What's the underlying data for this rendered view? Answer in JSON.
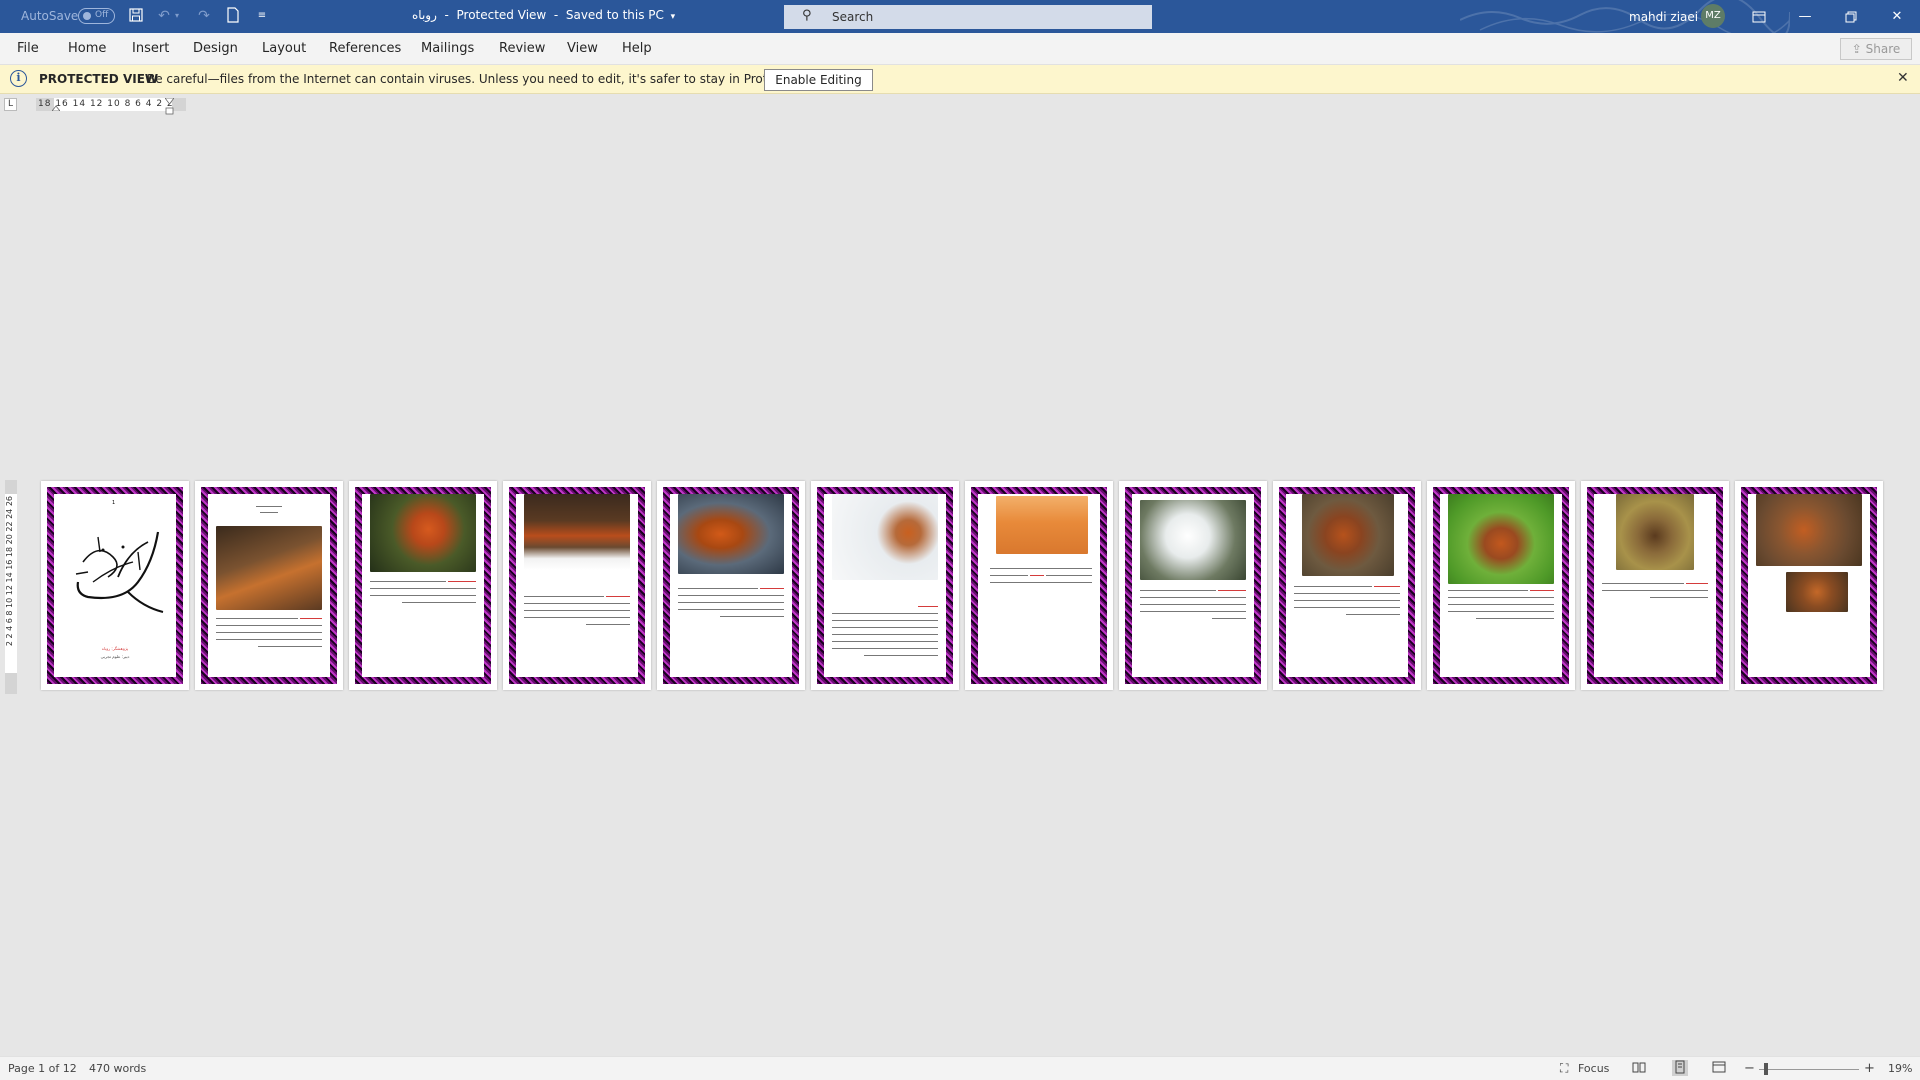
{
  "titlebar": {
    "autosave_label": "AutoSave",
    "autosave_state": "Off",
    "doc_name": "روباه",
    "separator": "-",
    "view_mode": "Protected View",
    "save_status": "Saved to this PC",
    "search_placeholder": "Search",
    "user_name": "mahdi ziaei",
    "user_initials": "MZ",
    "accent": "#2b579a"
  },
  "menu": {
    "items": [
      "File",
      "Home",
      "Insert",
      "Design",
      "Layout",
      "References",
      "Mailings",
      "Review",
      "View",
      "Help"
    ],
    "share_label": "Share"
  },
  "protected": {
    "label": "PROTECTED VIEW",
    "message": "Be careful—files from the Internet can contain viruses. Unless you need to edit, it's safer to stay in Protected View.",
    "button": "Enable Editing",
    "background": "#fdf6cd"
  },
  "ruler": {
    "horizontal": "18  16 14 12 10  8  6  4  2     2",
    "vertical": "2  2  4  6  8  10 12 14 16 18 20 22 24 26"
  },
  "document": {
    "page_count": 12,
    "page1_number": "1",
    "page1_author_line": "پژوهشگر: روباه",
    "page1_sub_line": "دبیر: علوم تجربی"
  },
  "status": {
    "page": "Page 1 of 12",
    "words": "470 words",
    "focus": "Focus",
    "zoom": "19%"
  },
  "icons": {
    "save": "save-icon",
    "undo": "undo-icon",
    "redo": "redo-icon",
    "new": "new-document-icon",
    "customize": "customize-qat-icon",
    "search": "search-icon",
    "ribbon_display": "ribbon-display-icon",
    "minimize": "minimize-icon",
    "restore": "restore-icon",
    "close": "close-icon",
    "info": "info-icon"
  }
}
